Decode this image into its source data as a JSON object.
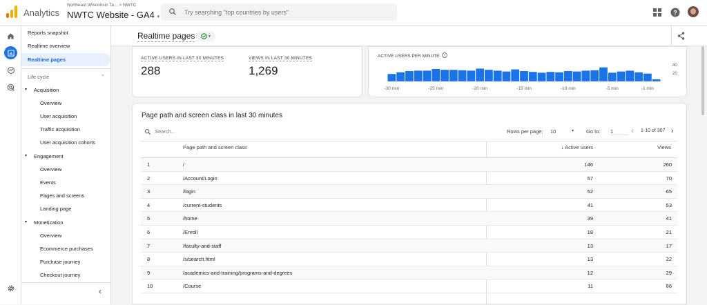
{
  "topbar": {
    "app_name": "Analytics",
    "account_path": "Northeast Wisconsin Te... > NWTC",
    "property": "NWTC Website - GA4",
    "search_placeholder": "Try searching \"top countries by users\"",
    "brand_colors": {
      "orange": "#f9ab00",
      "dark_orange": "#e37400"
    }
  },
  "rail": {
    "icons": [
      "home-icon",
      "reports-icon",
      "explore-icon",
      "advertising-icon",
      "settings-icon"
    ]
  },
  "nav": {
    "top_items": [
      "Reports snapshot",
      "Realtime overview",
      "Realtime pages"
    ],
    "section_title": "Life cycle",
    "groups": [
      {
        "label": "Acquisition",
        "items": [
          "Overview",
          "User acquisition",
          "Traffic acquisition",
          "User acquisition cohorts"
        ]
      },
      {
        "label": "Engagement",
        "items": [
          "Overview",
          "Events",
          "Pages and screens",
          "Landing page"
        ]
      },
      {
        "label": "Monetization",
        "items": [
          "Overview",
          "Ecommerce purchases",
          "Purchase journey",
          "Checkout journey"
        ]
      }
    ]
  },
  "page": {
    "title": "Realtime pages"
  },
  "kpis": [
    {
      "label": "ACTIVE USERS IN LAST 30 MINUTES",
      "value": "288"
    },
    {
      "label": "VIEWS IN LAST 30 MINUTES",
      "value": "1,269"
    }
  ],
  "chart_data": {
    "type": "bar",
    "title": "ACTIVE USERS PER MINUTE",
    "x_ticks": [
      "-30 min",
      "-25 min",
      "-20 min",
      "-15 min",
      "-10 min",
      "-5 min",
      "-1 min"
    ],
    "y_ticks": [
      40,
      20
    ],
    "ylim": [
      0,
      50
    ],
    "color": "#1a73e8",
    "values": [
      18,
      22,
      25,
      26,
      26,
      30,
      28,
      28,
      27,
      26,
      31,
      28,
      26,
      24,
      29,
      25,
      23,
      21,
      23,
      22,
      25,
      24,
      26,
      27,
      34,
      21,
      24,
      26,
      22,
      19,
      5
    ]
  },
  "table": {
    "title": "Page path and screen class in last 30 minutes",
    "search_placeholder": "Search...",
    "rows_per_page_label": "Rows per page:",
    "rows_per_page": "10",
    "goto_label": "Go to:",
    "goto_value": "1",
    "range": "1-10 of 307",
    "col_path": "Page path and screen class",
    "col_users": "Active users",
    "col_views": "Views",
    "rows": [
      {
        "rank": "1",
        "path": "/",
        "users": "146",
        "views": "260"
      },
      {
        "rank": "2",
        "path": "/Account/Login",
        "users": "57",
        "views": "70"
      },
      {
        "rank": "3",
        "path": "/login",
        "users": "52",
        "views": "65"
      },
      {
        "rank": "4",
        "path": "/current-students",
        "users": "41",
        "views": "53"
      },
      {
        "rank": "5",
        "path": "/home",
        "users": "39",
        "views": "41"
      },
      {
        "rank": "6",
        "path": "/Enroll",
        "users": "18",
        "views": "21"
      },
      {
        "rank": "7",
        "path": "/faculty-and-staff",
        "users": "13",
        "views": "17"
      },
      {
        "rank": "8",
        "path": "/s/search.html",
        "users": "13",
        "views": "22"
      },
      {
        "rank": "9",
        "path": "/academics-and-training/programs-and-degrees",
        "users": "12",
        "views": "29"
      },
      {
        "rank": "10",
        "path": "/Course",
        "users": "11",
        "views": "66"
      }
    ]
  }
}
